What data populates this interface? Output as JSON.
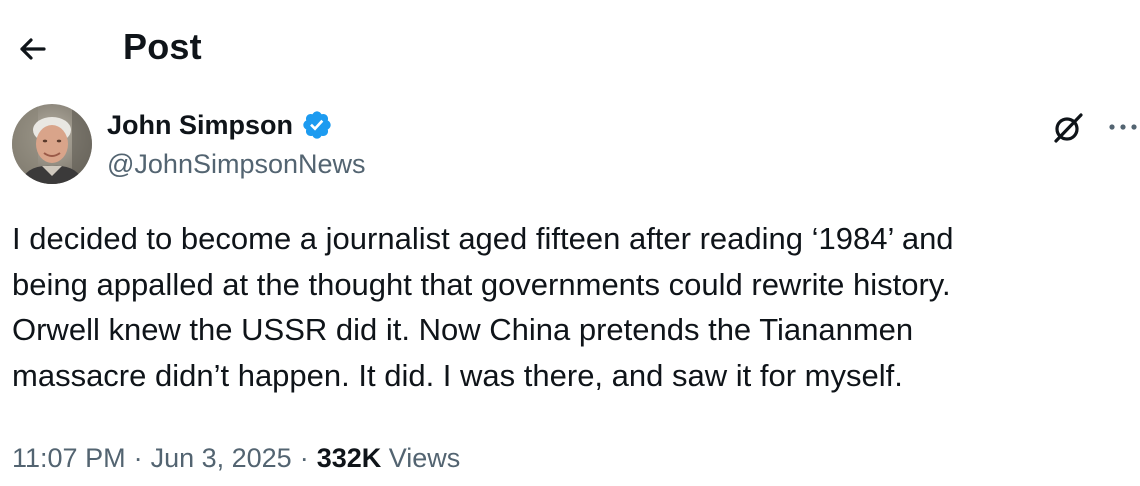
{
  "header": {
    "title": "Post",
    "back_icon": "arrow-left-icon"
  },
  "author": {
    "display_name": "John Simpson",
    "handle": "@JohnSimpsonNews",
    "verified": true,
    "verified_color": "#1d9bf0",
    "avatar_icon": "user-avatar-photo"
  },
  "actions": {
    "grok_icon": "grok-icon",
    "more_icon": "more-horizontal-icon"
  },
  "tweet": {
    "lines": [
      "I decided to become a journalist aged fifteen after reading ‘1984’ and",
      "being appalled at the thought that governments could rewrite history.",
      "Orwell knew the USSR did it.  Now China pretends the Tiananmen",
      "massacre didn’t happen.  It did.  I was there, and saw it for myself."
    ]
  },
  "meta": {
    "time": "11:07 PM",
    "separator": "·",
    "date": "Jun 3, 2025",
    "views_count": "332K",
    "views_label": "Views"
  },
  "colors": {
    "text_primary": "#0f1419",
    "text_secondary": "#536471",
    "accent": "#1d9bf0"
  }
}
